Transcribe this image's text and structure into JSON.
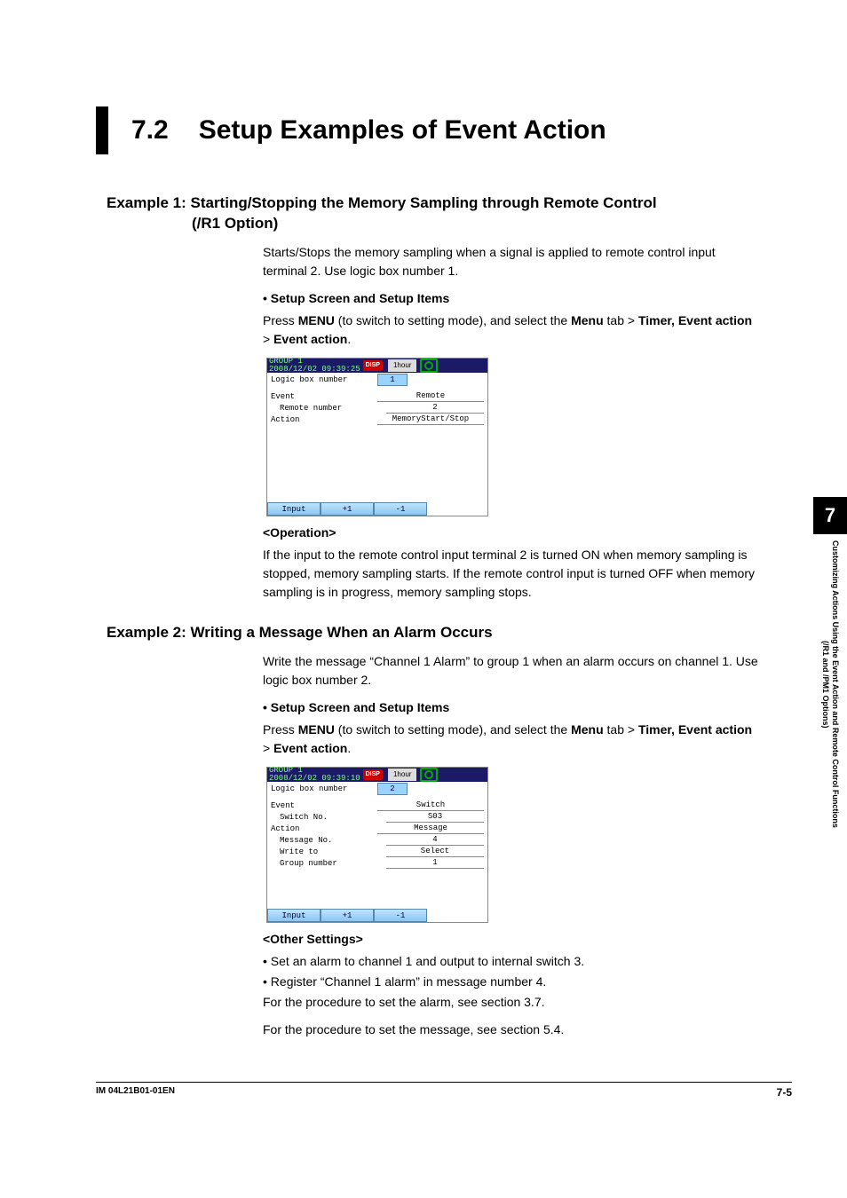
{
  "section": {
    "number": "7.2",
    "title": "Setup Examples of Event Action"
  },
  "example1": {
    "title_l1": "Example 1: Starting/Stopping the Memory Sampling through Remote Control",
    "title_l2": "(/R1 Option)",
    "intro": "Starts/Stops the memory sampling when a signal is applied to remote control input terminal 2. Use logic box number 1.",
    "setup_head": "Setup Screen and Setup Items",
    "setup_p1a": "Press ",
    "setup_menu": "MENU",
    "setup_p1b": " (to switch to setting mode), and select the ",
    "setup_menu2": "Menu",
    "setup_p1c": " tab > ",
    "setup_crumb1": "Timer, Event action",
    "setup_gt": " > ",
    "setup_crumb2": "Event action",
    "setup_period": ".",
    "op_head": "<Operation>",
    "op_body": "If the input to the remote control input terminal 2 is turned ON when memory sampling is stopped, memory sampling starts. If the remote control input is turned OFF when memory sampling is in progress, memory sampling stops.",
    "device": {
      "group": "GROUP 1",
      "timestamp": "2008/12/02 09:39:25",
      "disp_badge": "DISP",
      "interval": "1hour",
      "logic_lbl": "Logic box number",
      "logic_val": "1",
      "event_lbl": "Event",
      "event_val": "Remote",
      "remote_lbl": "Remote number",
      "remote_val": "2",
      "action_lbl": "Action",
      "action_val": "MemoryStart/Stop",
      "btn_input": "Input",
      "btn_plus": "+1",
      "btn_minus": "-1"
    }
  },
  "example2": {
    "title": "Example 2: Writing a Message When an Alarm Occurs",
    "intro": "Write the message “Channel 1 Alarm” to group 1 when an alarm occurs on channel 1. Use logic box number 2.",
    "setup_head": "Setup Screen and Setup Items",
    "setup_p1a": "Press ",
    "setup_menu": "MENU",
    "setup_p1b": " (to switch to setting mode), and select the ",
    "setup_menu2": "Menu",
    "setup_p1c": " tab > ",
    "setup_crumb1": "Timer, Event action",
    "setup_gt": " > ",
    "setup_crumb2": "Event action",
    "setup_period": ".",
    "other_head": "<Other Settings>",
    "other_b1": "Set an alarm to channel 1 and output to internal switch 3.",
    "other_b2": "Register “Channel 1 alarm” in message number 4.",
    "other_l1": "For the procedure to set the alarm, see section 3.7.",
    "other_l2": "For the procedure to set the message, see section 5.4.",
    "device": {
      "group": "GROUP 1",
      "timestamp": "2008/12/02 09:39:10",
      "disp_badge": "DISP",
      "interval": "1hour",
      "logic_lbl": "Logic box number",
      "logic_val": "2",
      "event_lbl": "Event",
      "event_val": "Switch",
      "switch_lbl": "Switch No.",
      "switch_val": "S03",
      "action_lbl": "Action",
      "action_val": "Message",
      "msg_lbl": "Message No.",
      "msg_val": "4",
      "write_lbl": "Write to",
      "write_val": "Select",
      "grp_lbl": "Group number",
      "grp_val": "1",
      "btn_input": "Input",
      "btn_plus": "+1",
      "btn_minus": "-1"
    }
  },
  "side": {
    "chapter": "7",
    "label": "Customizing Actions Using the Event Action and Remote Control Functions (/R1 and /PM1 Options)"
  },
  "footer": {
    "docid": "IM 04L21B01-01EN",
    "page": "7-5"
  }
}
